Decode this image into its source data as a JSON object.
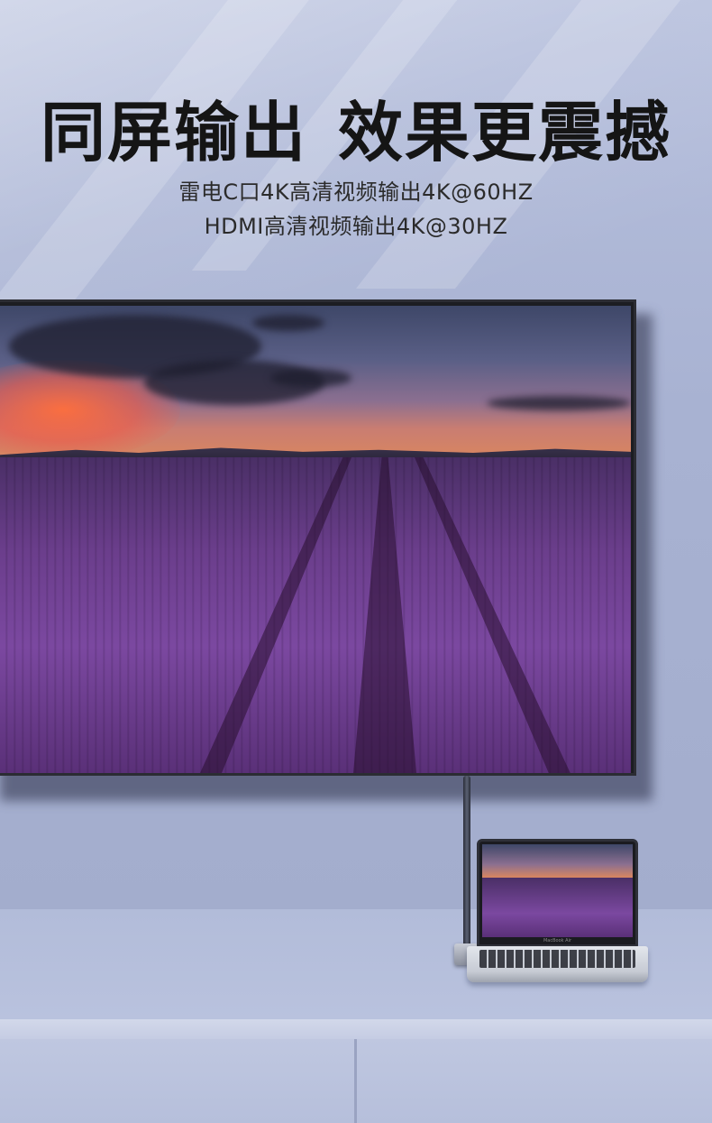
{
  "headline": {
    "part1": "同屏输出",
    "part2": "效果更震撼"
  },
  "subtitle": {
    "line1": "雷电C口4K高清视频输出4K@60HZ",
    "line2": "HDMI高清视频输出4K@30HZ"
  },
  "laptop": {
    "brand": "MacBook Air"
  },
  "colors": {
    "wall": "#a9b3d0",
    "headline_text": "#151515",
    "subtitle_text": "#2b2b2b",
    "lavender": "#7b48a0"
  }
}
